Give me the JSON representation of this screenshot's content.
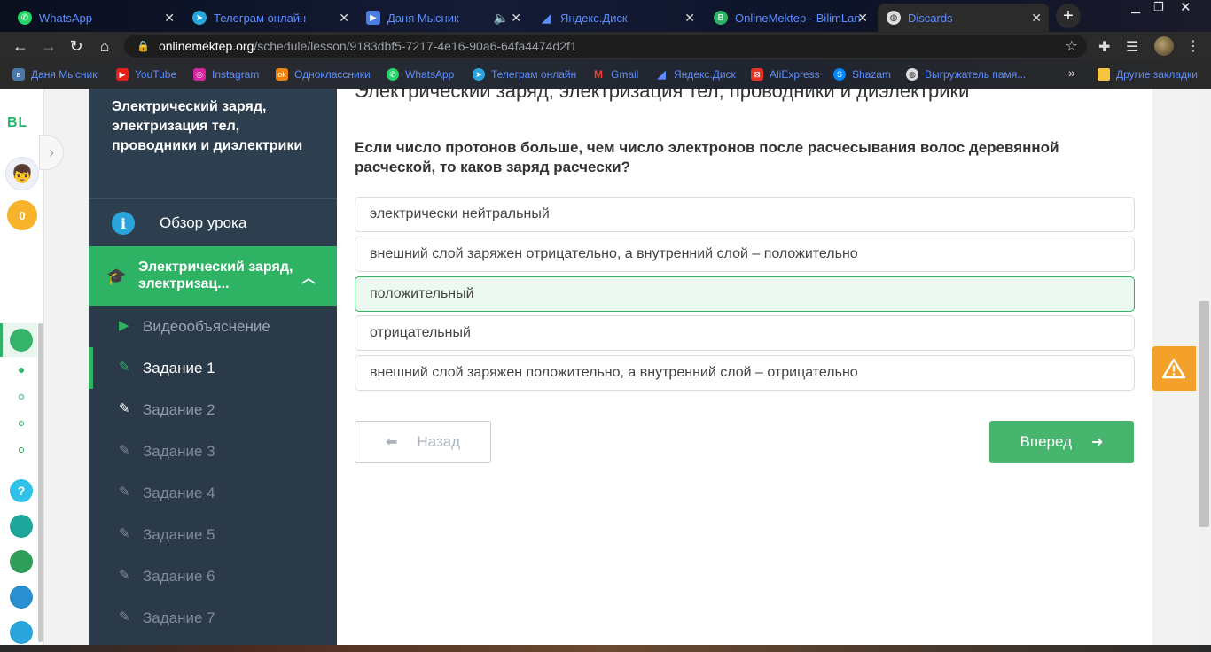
{
  "browser": {
    "tabs": [
      {
        "title": "WhatsApp",
        "icon": "whatsapp-icon",
        "color": "#25d366"
      },
      {
        "title": "Телеграм онлайн",
        "icon": "telegram-icon",
        "color": "#2aa5dc"
      },
      {
        "title": "Даня Мысник",
        "icon": "youtube-video-icon",
        "color": "#4a7fe0"
      },
      {
        "title": "Яндекс.Диск",
        "icon": "yandex-disk-icon",
        "color": "#5c8dff"
      },
      {
        "title": "OnlineMektep - BilimLan",
        "icon": "bilimland-icon",
        "color": "#2eb264"
      },
      {
        "title": "Discards",
        "icon": "globe-icon",
        "color": "#ddd"
      }
    ],
    "url_host": "onlinemektep.org",
    "url_path": "/schedule/lesson/9183dbf5-7217-4e16-90a6-64fa4474d2f1",
    "bookmarks": [
      {
        "label": "Даня Мысник",
        "icon": "vk-icon",
        "color": "#4a76a8"
      },
      {
        "label": "YouTube",
        "icon": "youtube-icon",
        "color": "#e62117"
      },
      {
        "label": "Instagram",
        "icon": "instagram-icon",
        "color": "#d6249f"
      },
      {
        "label": "Одноклассники",
        "icon": "odnoklassniki-icon",
        "color": "#ee8208"
      },
      {
        "label": "WhatsApp",
        "icon": "whatsapp-icon",
        "color": "#25d366"
      },
      {
        "label": "Телеграм онлайн",
        "icon": "telegram-icon",
        "color": "#2aa5dc"
      },
      {
        "label": "Gmail",
        "icon": "gmail-icon",
        "color": "#ea4335"
      },
      {
        "label": "Яндекс.Диск",
        "icon": "yandex-disk-icon",
        "color": "#5c8dff"
      },
      {
        "label": "AliExpress",
        "icon": "aliexpress-icon",
        "color": "#e43225"
      },
      {
        "label": "Shazam",
        "icon": "shazam-icon",
        "color": "#0088ff"
      },
      {
        "label": "Выгружатель памя...",
        "icon": "globe-icon",
        "color": "#ddd"
      }
    ],
    "overflow": "»",
    "other_bookmarks": "Другие закладки"
  },
  "rail": {
    "logo": "BL",
    "coins": "0"
  },
  "sidebar": {
    "lesson_title": "Электрический заряд, электризация тел, проводники и диэлектрики",
    "overview": "Обзор урока",
    "topic": "Электрический заряд, электризац...",
    "items": [
      {
        "label": "Видеообъяснение"
      },
      {
        "label": "Задание 1"
      },
      {
        "label": "Задание 2"
      },
      {
        "label": "Задание 3"
      },
      {
        "label": "Задание 4"
      },
      {
        "label": "Задание 5"
      },
      {
        "label": "Задание 6"
      },
      {
        "label": "Задание 7"
      }
    ]
  },
  "main": {
    "title": "Электрический заряд, электризация тел, проводники и диэлектрики",
    "question": "Если число протонов больше, чем число электронов после расчесывания волос деревянной расческой, то каков заряд расчески?",
    "options": [
      "электрически нейтральный",
      "внешний слой заряжен отрицательно, а внутренний слой – положительно",
      "положительный",
      "отрицательный",
      "внешний слой заряжен положительно, а внутренний слой – отрицательно"
    ],
    "selected_option": 2,
    "back_label": "Назад",
    "next_label": "Вперед"
  },
  "colors": {
    "accent_green": "#2eb264",
    "sidebar_bg": "#2d3e4e",
    "warning_orange": "#f4a12c"
  }
}
